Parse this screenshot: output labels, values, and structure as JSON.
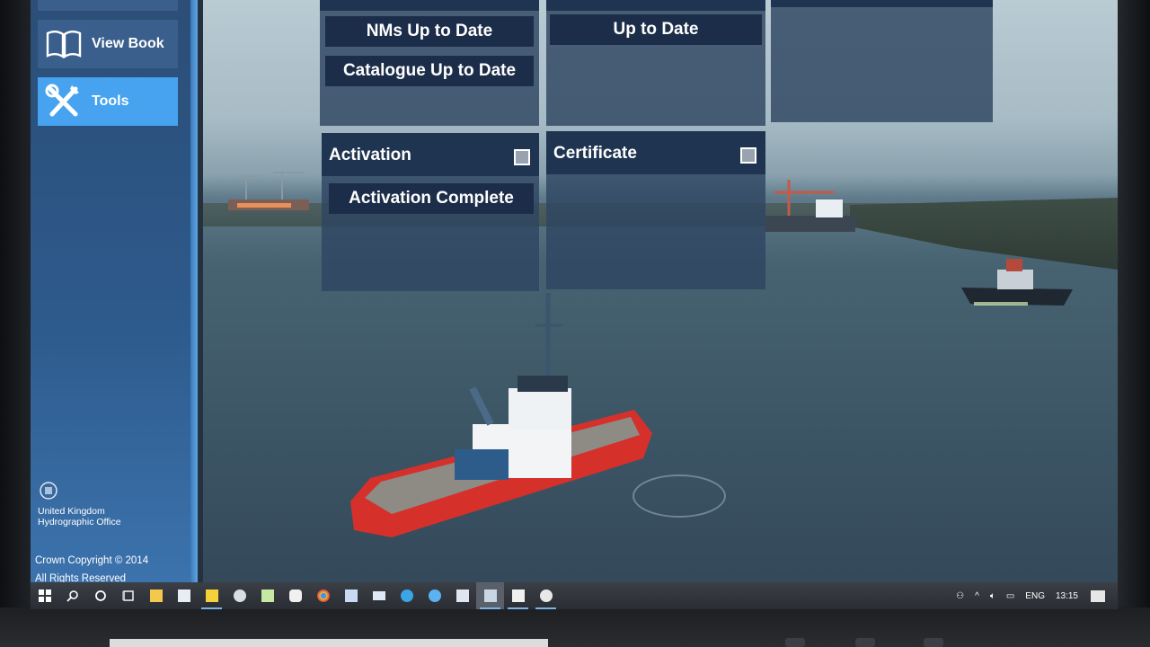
{
  "sidebar": {
    "items": [
      {
        "label": "",
        "icon": "blank-icon"
      },
      {
        "label": "View Book",
        "icon": "book-icon"
      },
      {
        "label": "Tools",
        "icon": "tools-icon"
      }
    ],
    "logo": {
      "line1": "United Kingdom",
      "line2": "Hydrographic Office"
    },
    "copyright": {
      "line1": "Crown Copyright © 2014",
      "line2": "All Rights Reserved"
    }
  },
  "tiles": {
    "updates": {
      "nms": "NMs Up to Date",
      "catalogue": "Catalogue Up to Date"
    },
    "status": {
      "value": "Up to Date"
    },
    "activation": {
      "title": "Activation",
      "value": "Activation Complete"
    },
    "certificate": {
      "title": "Certificate"
    }
  },
  "taskbar": {
    "icons": [
      "windows-start-icon",
      "search-icon",
      "cortana-icon",
      "task-view-icon",
      "file-explorer-icon",
      "word-icon",
      "sticky-notes-icon",
      "paint-icon",
      "excel-icon",
      "app-icon",
      "chrome-icon",
      "word-pad-icon",
      "mail-icon",
      "edge-icon",
      "internet-explorer-icon",
      "notepad-icon",
      "window-app-icon",
      "window-app-icon",
      "chat-icon"
    ],
    "language": "ENG",
    "time": "13:15"
  },
  "colors": {
    "sidebar": "#2d5a8c",
    "active_nav": "#47a3f0",
    "tile": "#2e4662",
    "chip": "#1c2d49"
  }
}
